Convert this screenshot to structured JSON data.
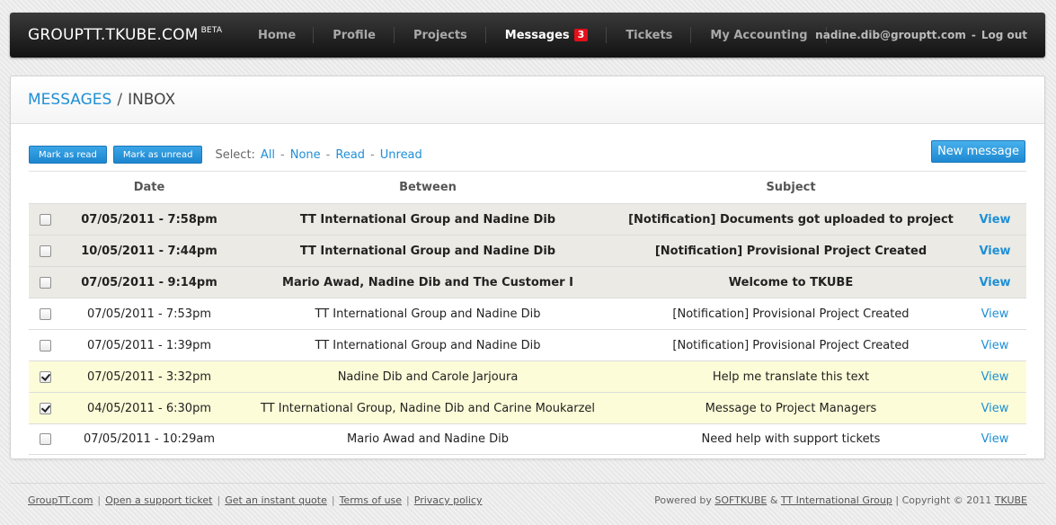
{
  "navbar": {
    "brand": "GROUPTT.TKUBE.COM",
    "brand_sup": "BETA",
    "items": [
      {
        "label": "Home"
      },
      {
        "label": "Profile"
      },
      {
        "label": "Projects"
      },
      {
        "label": "Messages",
        "badge": "3"
      },
      {
        "label": "Tickets"
      },
      {
        "label": "My Accounting"
      }
    ],
    "user_email": "nadine.dib@grouptt.com",
    "dash": "-",
    "logout": "Log out"
  },
  "breadcrumb": {
    "section": "MESSAGES",
    "separator": "/",
    "current": "INBOX"
  },
  "toolbar": {
    "mark_read": "Mark as read",
    "mark_unread": "Mark as unread",
    "select_label": "Select:",
    "select_all": "All",
    "select_none": "None",
    "select_read": "Read",
    "select_unread": "Unread",
    "dash": "-",
    "new_message": "New message"
  },
  "table": {
    "headers": {
      "date": "Date",
      "between": "Between",
      "subject": "Subject"
    },
    "rows": [
      {
        "date": "07/05/2011 - 7:58pm",
        "between": "TT International Group and Nadine Dib",
        "subject": "[Notification] Documents got uploaded to project",
        "view": "View",
        "unread": true,
        "checked": false
      },
      {
        "date": "10/05/2011 - 7:44pm",
        "between": "TT International Group and Nadine Dib",
        "subject": "[Notification] Provisional Project Created",
        "view": "View",
        "unread": true,
        "checked": false
      },
      {
        "date": "07/05/2011 - 9:14pm",
        "between": "Mario Awad, Nadine Dib and The Customer I",
        "subject": "Welcome to TKUBE",
        "view": "View",
        "unread": true,
        "checked": false
      },
      {
        "date": "07/05/2011 - 7:53pm",
        "between": "TT International Group and Nadine Dib",
        "subject": "[Notification] Provisional Project Created",
        "view": "View",
        "unread": false,
        "checked": false
      },
      {
        "date": "07/05/2011 - 1:39pm",
        "between": "TT International Group and Nadine Dib",
        "subject": "[Notification] Provisional Project Created",
        "view": "View",
        "unread": false,
        "checked": false
      },
      {
        "date": "07/05/2011 - 3:32pm",
        "between": "Nadine Dib and Carole Jarjoura",
        "subject": "Help me translate this text",
        "view": "View",
        "unread": false,
        "checked": true
      },
      {
        "date": "04/05/2011 - 6:30pm",
        "between": "TT International Group, Nadine Dib and Carine Moukarzel",
        "subject": "Message to Project Managers",
        "view": "View",
        "unread": false,
        "checked": true
      },
      {
        "date": "07/05/2011 - 10:29am",
        "between": "Mario Awad and Nadine Dib",
        "subject": "Need help with support tickets",
        "view": "View",
        "unread": false,
        "checked": false
      }
    ]
  },
  "footer": {
    "links": [
      "GroupTT.com",
      "Open a support ticket",
      "Get an instant quote",
      "Terms of use",
      "Privacy policy"
    ],
    "pipe": "|",
    "powered_by": "Powered by",
    "softkube": "SOFTKUBE",
    "amp": "&",
    "tt_group": "TT International Group",
    "copyright": "Copyright © 2011",
    "tkube": "TKUBE"
  },
  "colors": {
    "accent": "#1f8fd6",
    "badge": "#e3101a",
    "unread_row": "#ebeae4",
    "selected_row": "#fcfcd8"
  }
}
